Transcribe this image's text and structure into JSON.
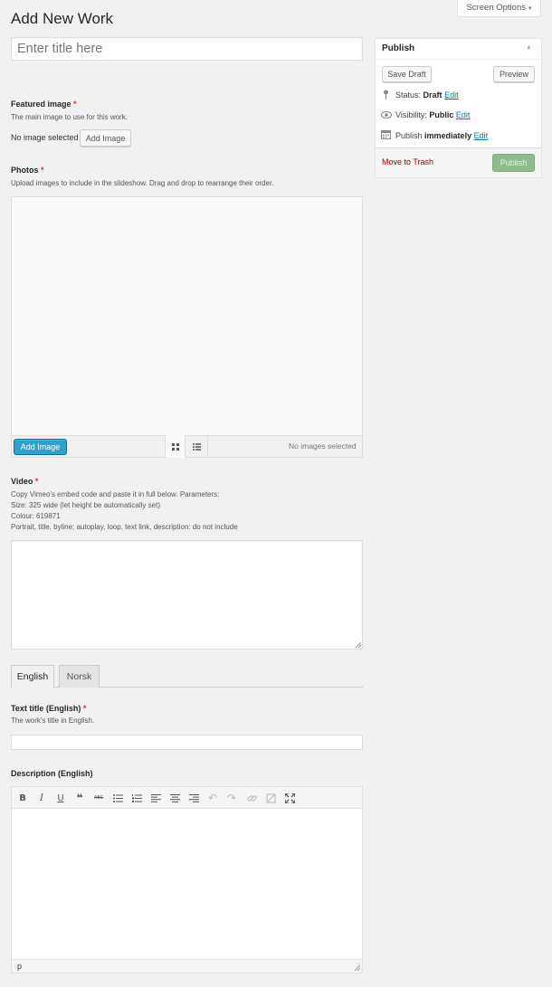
{
  "header": {
    "screen_options": "Screen Options",
    "page_title": "Add New Work"
  },
  "title_field": {
    "placeholder": "Enter title here"
  },
  "featured_image": {
    "label": "Featured image",
    "required": "*",
    "description": "The main image to use for this work.",
    "status": "No image selected",
    "button": "Add Image"
  },
  "photos": {
    "label": "Photos",
    "required": "*",
    "description": "Upload images to include in the slideshow. Drag and drop to rearrange their order.",
    "add_button": "Add Image",
    "count_text": "No images selected"
  },
  "video": {
    "label": "Video",
    "required": "*",
    "lines": [
      "Copy Vimeo's embed code and paste it in full below. Parameters:",
      "Size: 325 wide (let height be automatically set)",
      "Colour: 619871",
      "Portrait, title, byline; autoplay, loop, text link, description: do not include"
    ]
  },
  "language_tabs": [
    "English",
    "Norsk"
  ],
  "text_title": {
    "label": "Text title (English)",
    "required": "*",
    "description": "The work's title in English."
  },
  "description_editor": {
    "label": "Description (English)",
    "path": "p",
    "toolbar": [
      {
        "icon": "bold-icon",
        "glyph": "B"
      },
      {
        "icon": "italic-icon",
        "glyph": "I"
      },
      {
        "icon": "underline-icon",
        "glyph": "U"
      },
      {
        "icon": "blockquote-icon",
        "glyph": "❝"
      },
      {
        "icon": "strikethrough-icon",
        "glyph": "ABC"
      },
      {
        "icon": "bullet-list-icon",
        "glyph": "≔"
      },
      {
        "icon": "numbered-list-icon",
        "glyph": "⒈"
      },
      {
        "icon": "align-left-icon",
        "glyph": "≡"
      },
      {
        "icon": "align-center-icon",
        "glyph": "≡"
      },
      {
        "icon": "align-right-icon",
        "glyph": "≡"
      },
      {
        "icon": "undo-icon",
        "glyph": "↶"
      },
      {
        "icon": "redo-icon",
        "glyph": "↷"
      },
      {
        "icon": "link-icon",
        "glyph": "⛓"
      },
      {
        "icon": "unlink-icon",
        "glyph": "⛓"
      },
      {
        "icon": "fullscreen-icon",
        "glyph": "⤢"
      }
    ]
  },
  "publish": {
    "title": "Publish",
    "save_draft": "Save Draft",
    "preview": "Preview",
    "status_label": "Status:",
    "status_value": "Draft",
    "visibility_label": "Visibility:",
    "visibility_value": "Public",
    "publish_label": "Publish",
    "publish_value": "immediately",
    "edit": "Edit",
    "trash": "Move to Trash",
    "publish_button": "Publish"
  },
  "colors": {
    "primary_button": "#2ea2cc",
    "publish_disabled": "#8fbc8f",
    "link": "#0074a2",
    "required": "#dc3232",
    "trash": "#aa0000"
  }
}
